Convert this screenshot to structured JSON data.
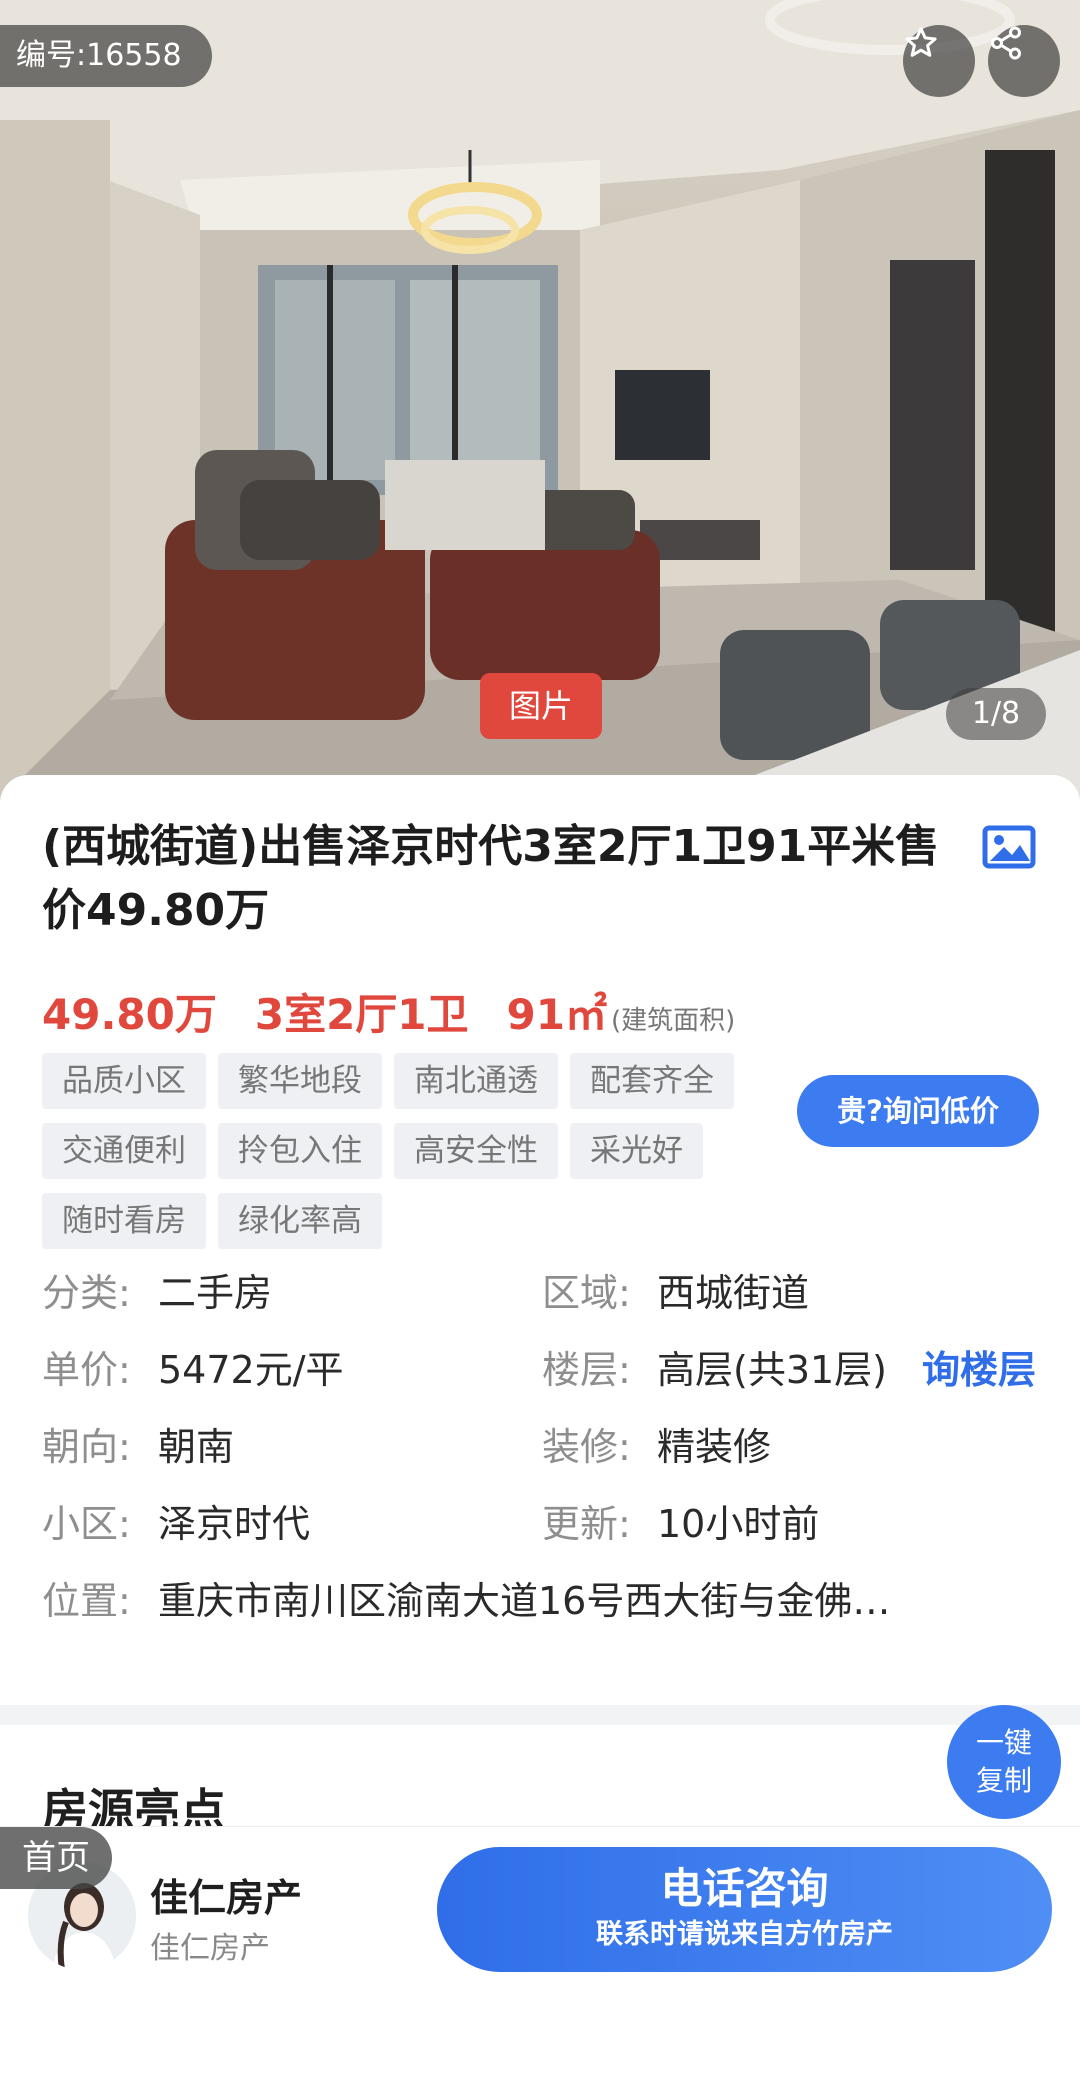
{
  "hero": {
    "listing_id": "编号:16558",
    "photo_tab": "图片",
    "counter": "1/8",
    "icons": [
      "star-icon",
      "share-icon"
    ]
  },
  "listing": {
    "title": "(西城街道)出售泽京时代3室2厅1卫91平米售价49.80万",
    "price": "49.80万",
    "layout": "3室2厅1卫",
    "area": "91㎡",
    "area_note": "(建筑面积)",
    "tags": [
      "品质小区",
      "繁华地段",
      "南北通透",
      "配套齐全",
      "交通便利",
      "拎包入住",
      "高安全性",
      "采光好",
      "随时看房",
      "绿化率高"
    ],
    "ask_price_button": "贵?询问低价"
  },
  "details": {
    "category_label": "分类:",
    "category": "二手房",
    "region_label": "区域:",
    "region": "西城街道",
    "unit_price_label": "单价:",
    "unit_price": "5472元/平",
    "floor_label": "楼层:",
    "floor": "高层(共31层)",
    "ask_floor": "询楼层",
    "orientation_label": "朝向:",
    "orientation": "朝南",
    "decoration_label": "装修:",
    "decoration": "精装修",
    "community_label": "小区:",
    "community": "泽京时代",
    "updated_label": "更新:",
    "updated": "10小时前",
    "location_label": "位置:",
    "location": "重庆市南川区渝南大道16号西大街与金佛…"
  },
  "copy_button": {
    "line1": "一键",
    "line2": "复制"
  },
  "section_title": "房源亮点",
  "bottom_bar": {
    "home_badge": "首页",
    "agent_name": "佳仁房产",
    "agent_company": "佳仁房产",
    "call_button": "电话咨询",
    "call_hint": "联系时请说来自方竹房产"
  },
  "colors": {
    "accent_blue": "#3c7cf0",
    "price_red": "#e0473d"
  }
}
